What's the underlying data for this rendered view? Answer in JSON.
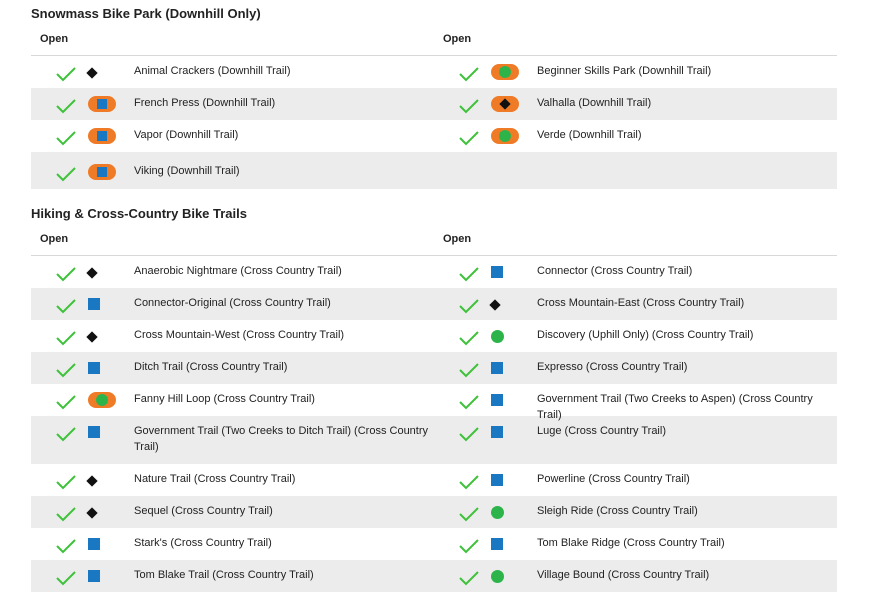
{
  "colors": {
    "check": "#3ec23a",
    "easier": "#1a78c2",
    "easiest": "#2cb44a",
    "difficult": "#111111",
    "terrain_park": "#f07b27",
    "row_shade": "#ececec"
  },
  "sections": [
    {
      "title": "Snowmass Bike Park (Downhill Only)",
      "col_header": "Open",
      "columns": [
        [
          {
            "name": "Animal Crackers (Downhill Trail)",
            "difficulty": "diamond",
            "status_icon": "check-icon"
          },
          {
            "name": "French Press (Downhill Trail)",
            "difficulty": "orange-square",
            "status_icon": "check-icon"
          },
          {
            "name": "Vapor (Downhill Trail)",
            "difficulty": "orange-square",
            "status_icon": "check-icon"
          },
          {
            "name": "Viking (Downhill Trail)",
            "difficulty": "orange-square",
            "status_icon": "check-icon"
          }
        ],
        [
          {
            "name": "Beginner Skills Park (Downhill Trail)",
            "difficulty": "orange-circle",
            "status_icon": "check-icon"
          },
          {
            "name": "Valhalla (Downhill Trail)",
            "difficulty": "orange-diamond",
            "status_icon": "check-icon"
          },
          {
            "name": "Verde (Downhill Trail)",
            "difficulty": "orange-circle",
            "status_icon": "check-icon"
          }
        ]
      ]
    },
    {
      "title": "Hiking & Cross-Country Bike Trails",
      "col_header": "Open",
      "columns": [
        [
          {
            "name": "Anaerobic Nightmare (Cross Country Trail)",
            "difficulty": "diamond"
          },
          {
            "name": "Connector-Original (Cross Country Trail)",
            "difficulty": "square"
          },
          {
            "name": "Cross Mountain-West (Cross Country Trail)",
            "difficulty": "diamond"
          },
          {
            "name": "Ditch Trail (Cross Country Trail)",
            "difficulty": "square"
          },
          {
            "name": "Fanny Hill Loop (Cross Country Trail)",
            "difficulty": "orange-circle"
          },
          {
            "name": "Government Trail (Two Creeks to Ditch Trail) (Cross Country Trail)",
            "difficulty": "square"
          },
          {
            "name": "Nature Trail (Cross Country Trail)",
            "difficulty": "diamond"
          },
          {
            "name": "Sequel (Cross Country Trail)",
            "difficulty": "diamond"
          },
          {
            "name": "Stark's (Cross Country Trail)",
            "difficulty": "square"
          },
          {
            "name": "Tom Blake Trail (Cross Country Trail)",
            "difficulty": "square"
          }
        ],
        [
          {
            "name": "Connector (Cross Country Trail)",
            "difficulty": "square"
          },
          {
            "name": "Cross Mountain-East (Cross Country Trail)",
            "difficulty": "diamond"
          },
          {
            "name": "Discovery (Uphill Only) (Cross Country Trail)",
            "difficulty": "circle"
          },
          {
            "name": "Expresso (Cross Country Trail)",
            "difficulty": "square"
          },
          {
            "name": "Government Trail (Two Creeks to Aspen) (Cross Country Trail)",
            "difficulty": "square"
          },
          {
            "name": "Luge (Cross Country Trail)",
            "difficulty": "square"
          },
          {
            "name": "Powerline (Cross Country Trail)",
            "difficulty": "square"
          },
          {
            "name": "Sleigh Ride (Cross Country Trail)",
            "difficulty": "circle"
          },
          {
            "name": "Tom Blake Ridge (Cross Country Trail)",
            "difficulty": "square"
          },
          {
            "name": "Village Bound (Cross Country Trail)",
            "difficulty": "circle"
          }
        ]
      ]
    }
  ]
}
